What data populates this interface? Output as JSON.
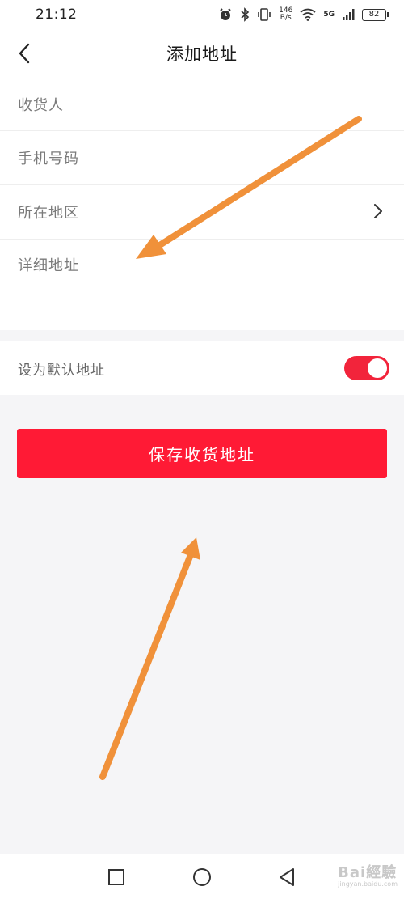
{
  "status_bar": {
    "time": "21:12",
    "net_speed_value": "146",
    "net_speed_unit": "B/s",
    "network_type": "5G",
    "battery_level": "82"
  },
  "header": {
    "title": "添加地址"
  },
  "form": {
    "recipient_placeholder": "收货人",
    "phone_placeholder": "手机号码",
    "region_label": "所在地区",
    "detail_placeholder": "详细地址"
  },
  "default_setting": {
    "label": "设为默认地址",
    "enabled": true
  },
  "actions": {
    "save_label": "保存收货地址"
  },
  "watermark": {
    "text": "Bai經驗",
    "sub": "jingyan.baidu.com"
  },
  "colors": {
    "accent": "#ff1a35",
    "annotation_arrow": "#f0913a"
  },
  "icons": {
    "back": "chevron-left-icon",
    "region": "chevron-right-icon",
    "alarm": "alarm-icon",
    "bluetooth": "bluetooth-icon",
    "vibrate": "vibrate-icon",
    "wifi": "wifi-icon",
    "signal": "signal-icon",
    "battery": "battery-icon",
    "nav_recent": "square-icon",
    "nav_home": "circle-icon",
    "nav_back": "triangle-back-icon"
  }
}
